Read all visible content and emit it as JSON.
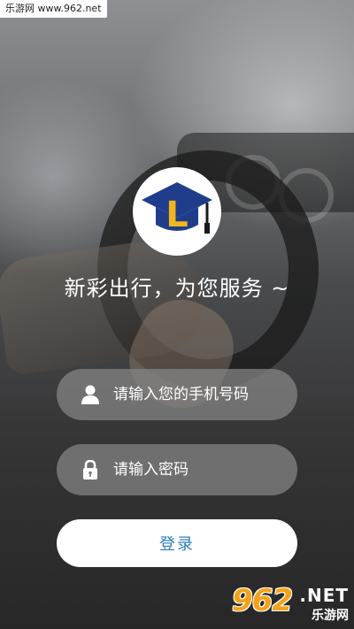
{
  "watermark_top": "乐游网 www.962.net",
  "logo": {
    "letter": "L",
    "colors": {
      "cap": "#1f3d8a",
      "letter": "#f2b51c",
      "tassel": "#1a1a1a"
    }
  },
  "slogan": "新彩出行，为您服务 ~",
  "phone": {
    "placeholder": "请输入您的手机号码",
    "value": "",
    "icon": "user-icon"
  },
  "password": {
    "placeholder": "请输入密码",
    "value": "",
    "icon": "lock-icon"
  },
  "login_label": "登录",
  "accent_color": "#2c7fbf",
  "watermark_bottom": {
    "number": "962",
    "domain": ".NET",
    "chinese": "乐游网"
  }
}
